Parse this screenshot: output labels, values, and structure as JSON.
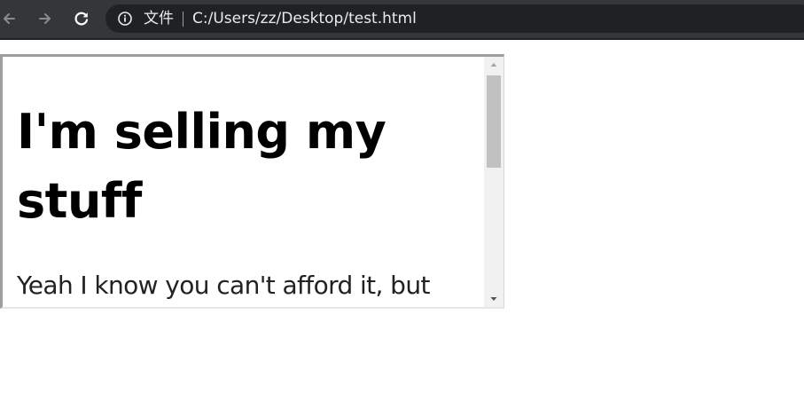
{
  "browser": {
    "page_label": "文件",
    "url": "C:/Users/zz/Desktop/test.html",
    "icons": {
      "back": "back-arrow-icon",
      "forward": "forward-arrow-icon",
      "reload": "reload-icon",
      "info": "info-icon"
    },
    "colors": {
      "toolbar": "#35363a",
      "omnibox": "#202124",
      "text": "#e8eaed"
    }
  },
  "frame": {
    "heading": "I'm selling my stuff",
    "body": "Yeah I know you can't afford it, but",
    "scrollbar": {
      "up_icon": "scroll-up-arrow-icon",
      "down_icon": "scroll-down-arrow-icon"
    }
  }
}
